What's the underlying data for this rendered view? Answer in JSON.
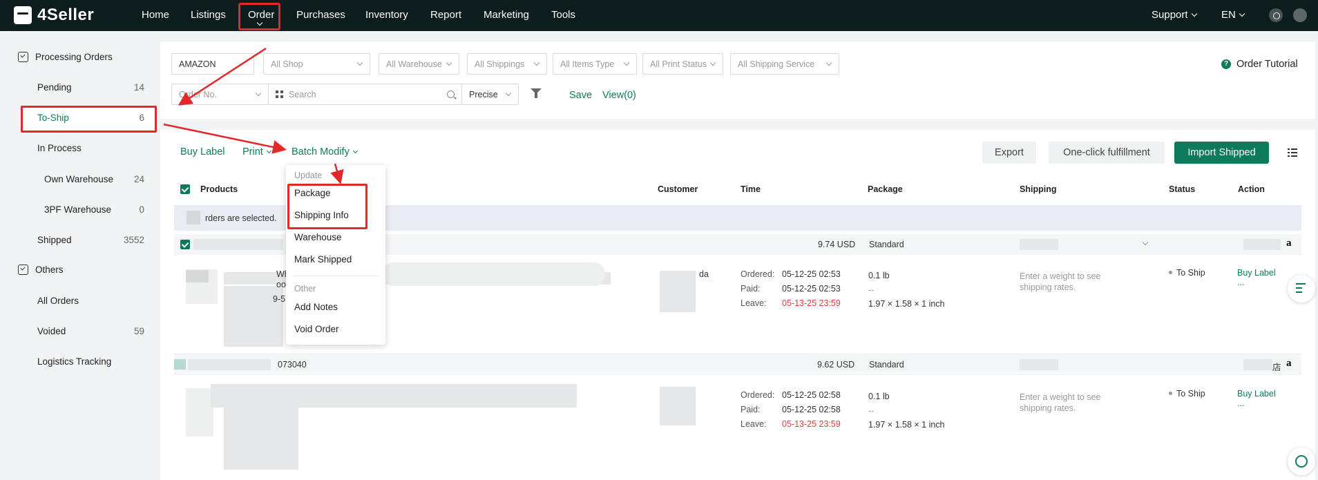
{
  "brand": {
    "name": "4Seller"
  },
  "nav": {
    "items": [
      "Home",
      "Listings",
      "Order",
      "Purchases",
      "Inventory",
      "Report",
      "Marketing",
      "Tools"
    ],
    "support": "Support",
    "lang": "EN"
  },
  "sidebar": {
    "group1": "Processing Orders",
    "pending": {
      "label": "Pending",
      "count": "14"
    },
    "toship": {
      "label": "To-Ship",
      "count": "6"
    },
    "inprocess": {
      "label": "In Process"
    },
    "own": {
      "label": "Own Warehouse",
      "count": "24"
    },
    "tpf": {
      "label": "3PF Warehouse",
      "count": "0"
    },
    "shipped": {
      "label": "Shipped",
      "count": "3552"
    },
    "group2": "Others",
    "all": {
      "label": "All Orders"
    },
    "voided": {
      "label": "Voided",
      "count": "59"
    },
    "logistics": {
      "label": "Logistics Tracking"
    }
  },
  "filters": {
    "platform": "AMAZON",
    "shop": "All Shop",
    "warehouse": "All Warehouse",
    "shippings": "All Shippings",
    "items_type": "All Items Type",
    "print_status": "All Print Status",
    "shipping_service": "All Shipping Service",
    "search_field": "Order No.",
    "search_placeholder": "Search",
    "match": "Precise",
    "save": "Save",
    "view": "View(0)",
    "tutorial": "Order Tutorial"
  },
  "actions": {
    "buy_label": "Buy Label",
    "print": "Print",
    "batch_modify": "Batch Modify",
    "export": "Export",
    "one_click": "One-click fulfillment",
    "import_shipped": "Import Shipped"
  },
  "table": {
    "headers": [
      "Products",
      "Customer",
      "Time",
      "Package",
      "Shipping",
      "Status",
      "Action"
    ],
    "selected_banner": "rders are selected."
  },
  "orders": [
    {
      "amount": "9.74 USD",
      "package_type": "Standard",
      "customer_fragment": "da",
      "ordered_label": "Ordered:",
      "ordered": "05-12-25 02:53",
      "paid_label": "Paid:",
      "paid": "05-12-25 02:53",
      "leave_label": "Leave:",
      "leave": "05-13-25 23:59",
      "weight": "0.1 lb",
      "dash": "--",
      "dims": "1.97 × 1.58 × 1 inch",
      "shipping_hint": "Enter a weight to see shipping rates.",
      "status": "To Ship",
      "action": "Buy Label",
      "more": "...",
      "frag1": "Wh",
      "frag2": "oo",
      "frag3": "9-5"
    },
    {
      "order_no_fragment": "073040",
      "amount": "9.62 USD",
      "package_type": "Standard",
      "shop_fragment": "店",
      "ordered_label": "Ordered:",
      "ordered": "05-12-25 02:58",
      "paid_label": "Paid:",
      "paid": "05-12-25 02:58",
      "leave_label": "Leave:",
      "leave": "05-13-25 23:59",
      "weight": "0.1 lb",
      "dash": "--",
      "dims": "1.97 × 1.58 × 1 inch",
      "shipping_hint": "Enter a weight to see shipping rates.",
      "status": "To Ship",
      "action": "Buy Label",
      "more": "..."
    }
  ],
  "dropdown": {
    "update_header": "Update",
    "package": "Package",
    "shipping_info": "Shipping Info",
    "warehouse": "Warehouse",
    "mark_shipped": "Mark Shipped",
    "other_header": "Other",
    "add_notes": "Add Notes",
    "void_order": "Void Order"
  },
  "colors": {
    "brand_green": "#0e7a5c",
    "highlight_red": "#e62727",
    "nav_bg": "#0d1c1c"
  }
}
